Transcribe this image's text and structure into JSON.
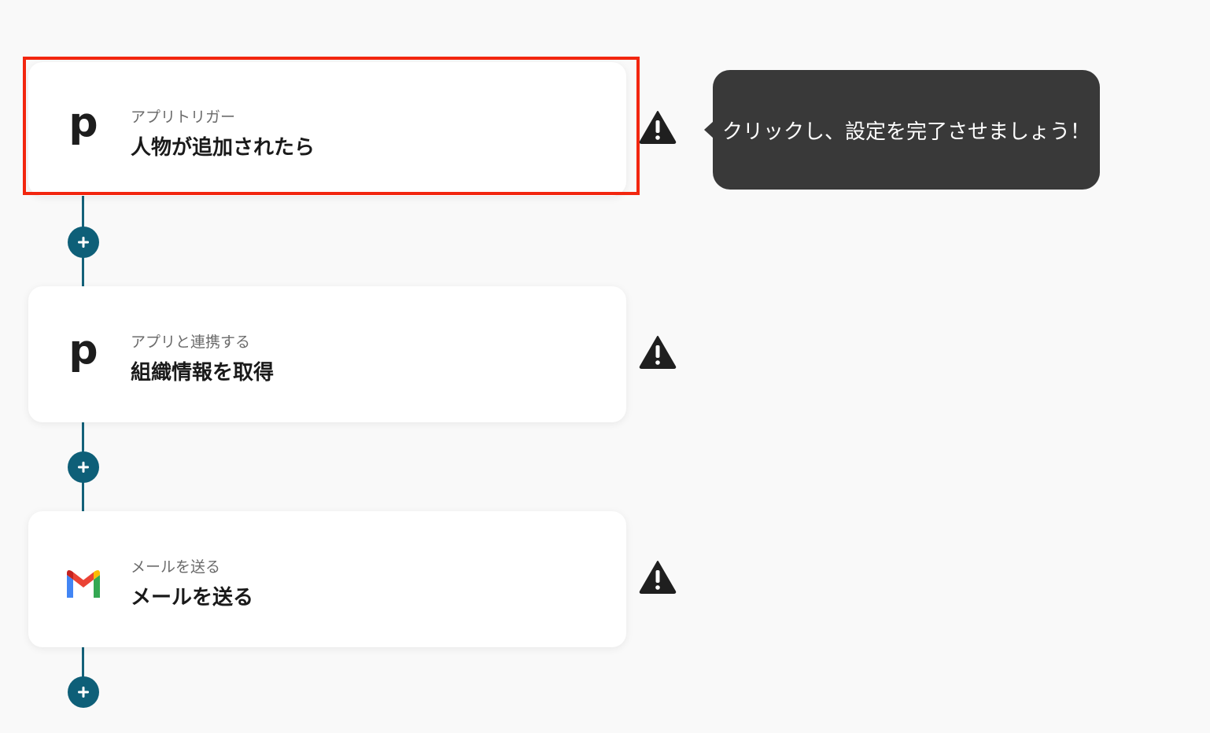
{
  "steps": [
    {
      "app_icon": "pipedrive-p-icon",
      "icon_glyph": "p",
      "subtitle": "アプリトリガー",
      "title": "人物が追加されたら",
      "status": "warning-icon",
      "selected": true
    },
    {
      "app_icon": "pipedrive-p-icon",
      "icon_glyph": "p",
      "subtitle": "アプリと連携する",
      "title": "組織情報を取得",
      "status": "warning-icon",
      "selected": false
    },
    {
      "app_icon": "gmail-icon",
      "subtitle": "メールを送る",
      "title": "メールを送る",
      "status": "warning-icon",
      "selected": false
    }
  ],
  "tooltip": {
    "text": "クリックし、設定を完了させましょう！"
  },
  "colors": {
    "connector": "#14627a",
    "add_button": "#0e5f78",
    "selection_border": "#f2260f",
    "tooltip_bg": "#393939",
    "page_bg": "#f9f9f9"
  },
  "add_step_buttons": [
    {
      "icon": "plus-icon"
    },
    {
      "icon": "plus-icon"
    },
    {
      "icon": "plus-icon"
    }
  ]
}
